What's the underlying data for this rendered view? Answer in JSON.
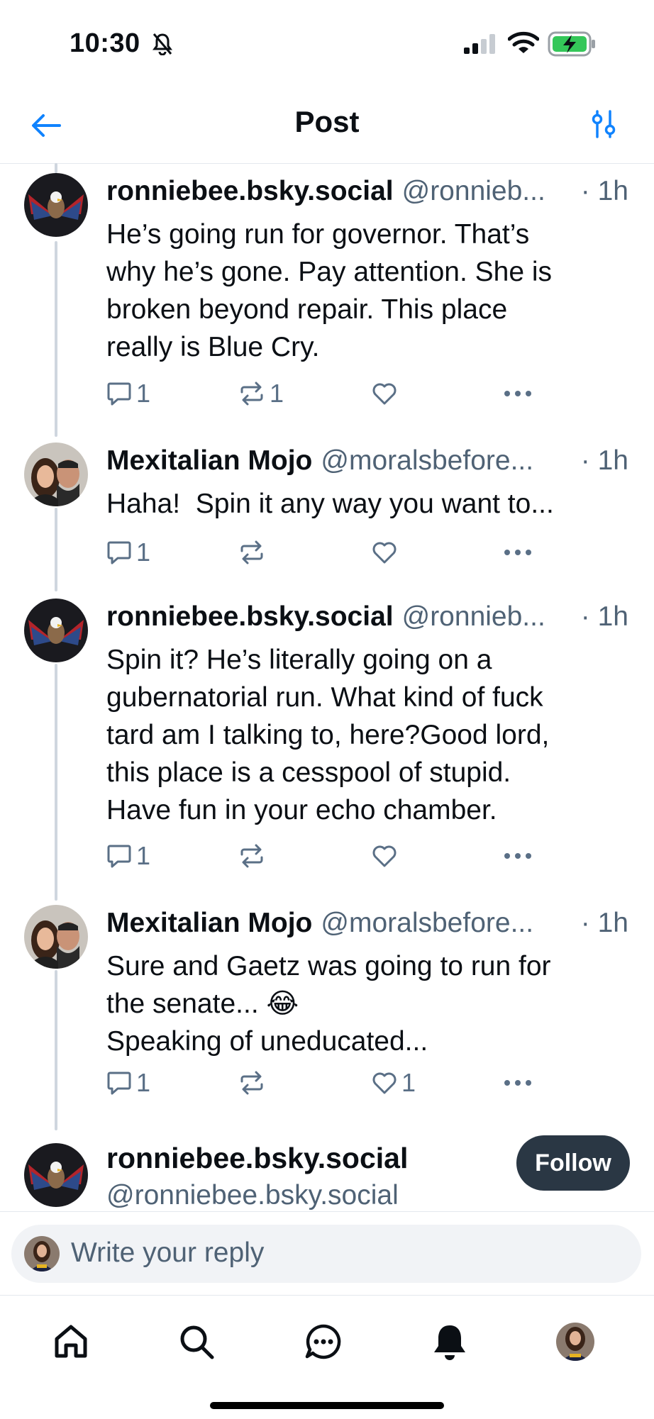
{
  "status_bar": {
    "time": "10:30"
  },
  "header": {
    "title": "Post"
  },
  "posts": [
    {
      "author": "ronniebee.bsky.social",
      "handle": "@ronnieb...",
      "time": "· 1h",
      "text": "He’s going run for governor. That’s\nwhy he’s gone. Pay attention. She is\nbroken beyond repair. This place\nreally is Blue Cry.",
      "reply_count": "1",
      "repost_count": "1",
      "like_count": ""
    },
    {
      "author": "Mexitalian Mojo",
      "handle": "@moralsbefore...",
      "time": "· 1h",
      "text": "Haha!  Spin it any way you want to...",
      "reply_count": "1",
      "repost_count": "",
      "like_count": ""
    },
    {
      "author": "ronniebee.bsky.social",
      "handle": "@ronnieb...",
      "time": "· 1h",
      "text": "Spin it? He’s literally going on a\ngubernatorial run. What kind of fuck\ntard am I talking to, here?Good lord,\nthis place is a cesspool of stupid.\nHave fun in your echo chamber.",
      "reply_count": "1",
      "repost_count": "",
      "like_count": ""
    },
    {
      "author": "Mexitalian Mojo",
      "handle": "@moralsbefore...",
      "time": "· 1h",
      "text_line1": "Sure and Gaetz was going to run for",
      "text_line2": "the senate... ",
      "text_emoji": "😂",
      "text_line3": "Speaking of uneducated...",
      "reply_count": "1",
      "repost_count": "",
      "like_count": "1"
    }
  ],
  "focused_post": {
    "author": "ronniebee.bsky.social",
    "handle": "@ronniebee.bsky.social",
    "follow_label": "Follow"
  },
  "composer": {
    "placeholder": "Write your reply"
  },
  "colors": {
    "accent": "#1083fe",
    "icon_gray": "#5a6f86",
    "follow_bg": "#2a3744"
  }
}
